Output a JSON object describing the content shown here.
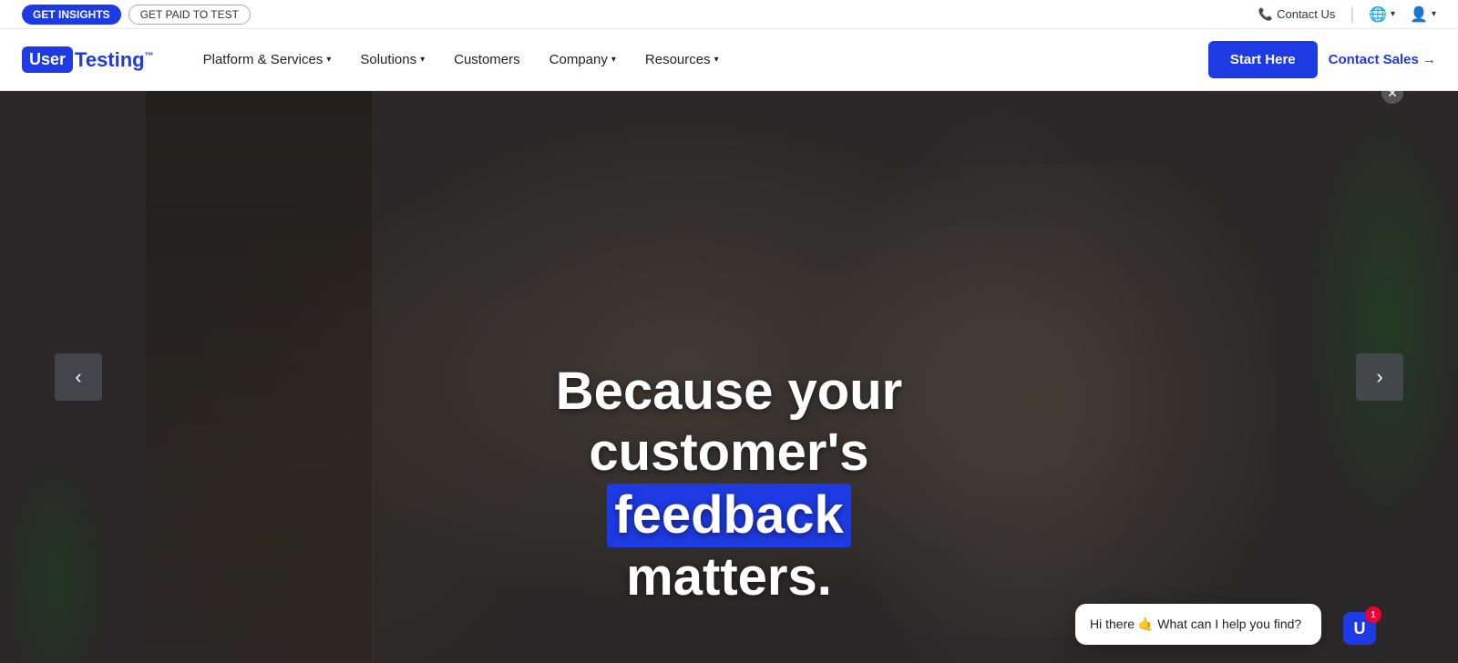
{
  "topbar": {
    "btn_insights": "GET INSIGHTS",
    "btn_paid": "GET PAID TO TEST",
    "contact_us": "Contact Us",
    "phone_icon": "📞",
    "globe_icon": "🌐",
    "person_icon": "👤"
  },
  "nav": {
    "logo_user": "User",
    "logo_testing": "Testing",
    "logo_tm": "™",
    "links": [
      {
        "label": "Platform & Services",
        "id": "platform-services"
      },
      {
        "label": "Solutions",
        "id": "solutions"
      },
      {
        "label": "Customers",
        "id": "customers"
      },
      {
        "label": "Company",
        "id": "company"
      },
      {
        "label": "Resources",
        "id": "resources"
      }
    ],
    "btn_start": "Start Here",
    "btn_contact_sales": "Contact Sales →"
  },
  "hero": {
    "line1": "Because your",
    "line2": "customer's",
    "word_highlight": "feedback",
    "line3": "matters."
  },
  "chat": {
    "message": "Hi there 🤙 What can I help you find?",
    "bot_label": "U",
    "badge": "1"
  },
  "carousel": {
    "prev_label": "‹",
    "next_label": "›"
  }
}
